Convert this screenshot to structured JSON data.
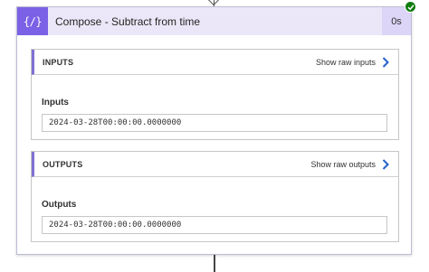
{
  "action": {
    "title": "Compose - Subtract from time",
    "duration": "0s",
    "icon": "compose-icon",
    "icon_glyph": "{∕}",
    "status": "succeeded",
    "accent_color": "#7b61e6",
    "status_color": "#107c10"
  },
  "inputs_section": {
    "header": "INPUTS",
    "raw_link": "Show raw inputs",
    "field_label": "Inputs",
    "field_value": "2024-03-28T00:00:00.0000000"
  },
  "outputs_section": {
    "header": "OUTPUTS",
    "raw_link": "Show raw outputs",
    "field_label": "Outputs",
    "field_value": "2024-03-28T00:00:00.0000000"
  }
}
